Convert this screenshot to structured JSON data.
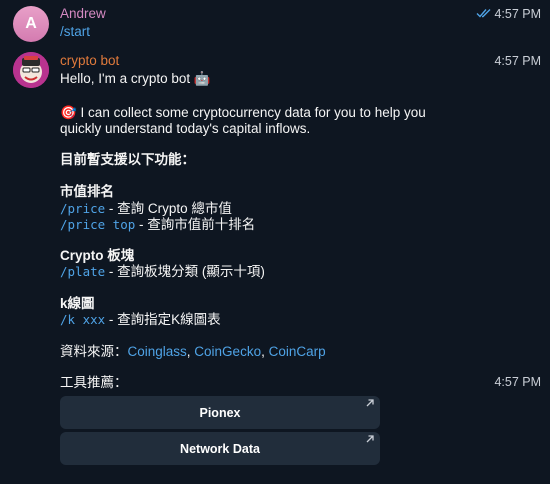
{
  "messages": {
    "user": {
      "avatar_letter": "A",
      "sender": "Andrew",
      "text": "/start",
      "time": "4:57 PM",
      "sender_color": "#d58ac2"
    },
    "bot": {
      "sender": "crypto bot",
      "time": "4:57 PM",
      "sender_color": "#e07a3c",
      "greeting": "Hello,  I'm a crypto bot 🤖",
      "intro_line1": "🎯 I can collect some cryptocurrency data for you to help you",
      "intro_line2": "quickly understand today's capital inflows.",
      "features_heading": "目前暫支援以下功能：",
      "section1_title": "市值排名",
      "cmd_price": "/price",
      "cmd_price_desc": " - 查詢 Crypto 總市值",
      "cmd_price_top": "/price top",
      "cmd_price_top_desc": " - 查詢市值前十排名",
      "section2_title": "Crypto 板塊",
      "cmd_plate": "/plate",
      "cmd_plate_desc": " - 查詢板塊分類 (顯示十項)",
      "section3_title": "k線圖",
      "cmd_k": "/k xxx",
      "cmd_k_desc": " - 查詢指定K線圖表",
      "sources_label": "資料來源：",
      "source1": "Coinglass",
      "source_sep": ", ",
      "source2": "CoinGecko",
      "source3": "CoinCarp"
    },
    "bot2": {
      "text": "工具推薦：",
      "time": "4:57 PM"
    }
  },
  "keyboard": {
    "buttons": [
      "Pionex",
      "Network Data"
    ]
  },
  "colors": {
    "background": "#0e1621",
    "link": "#4fa3e6",
    "button_bg": "#212d3b",
    "read_ticks": "#4fa3e6"
  }
}
